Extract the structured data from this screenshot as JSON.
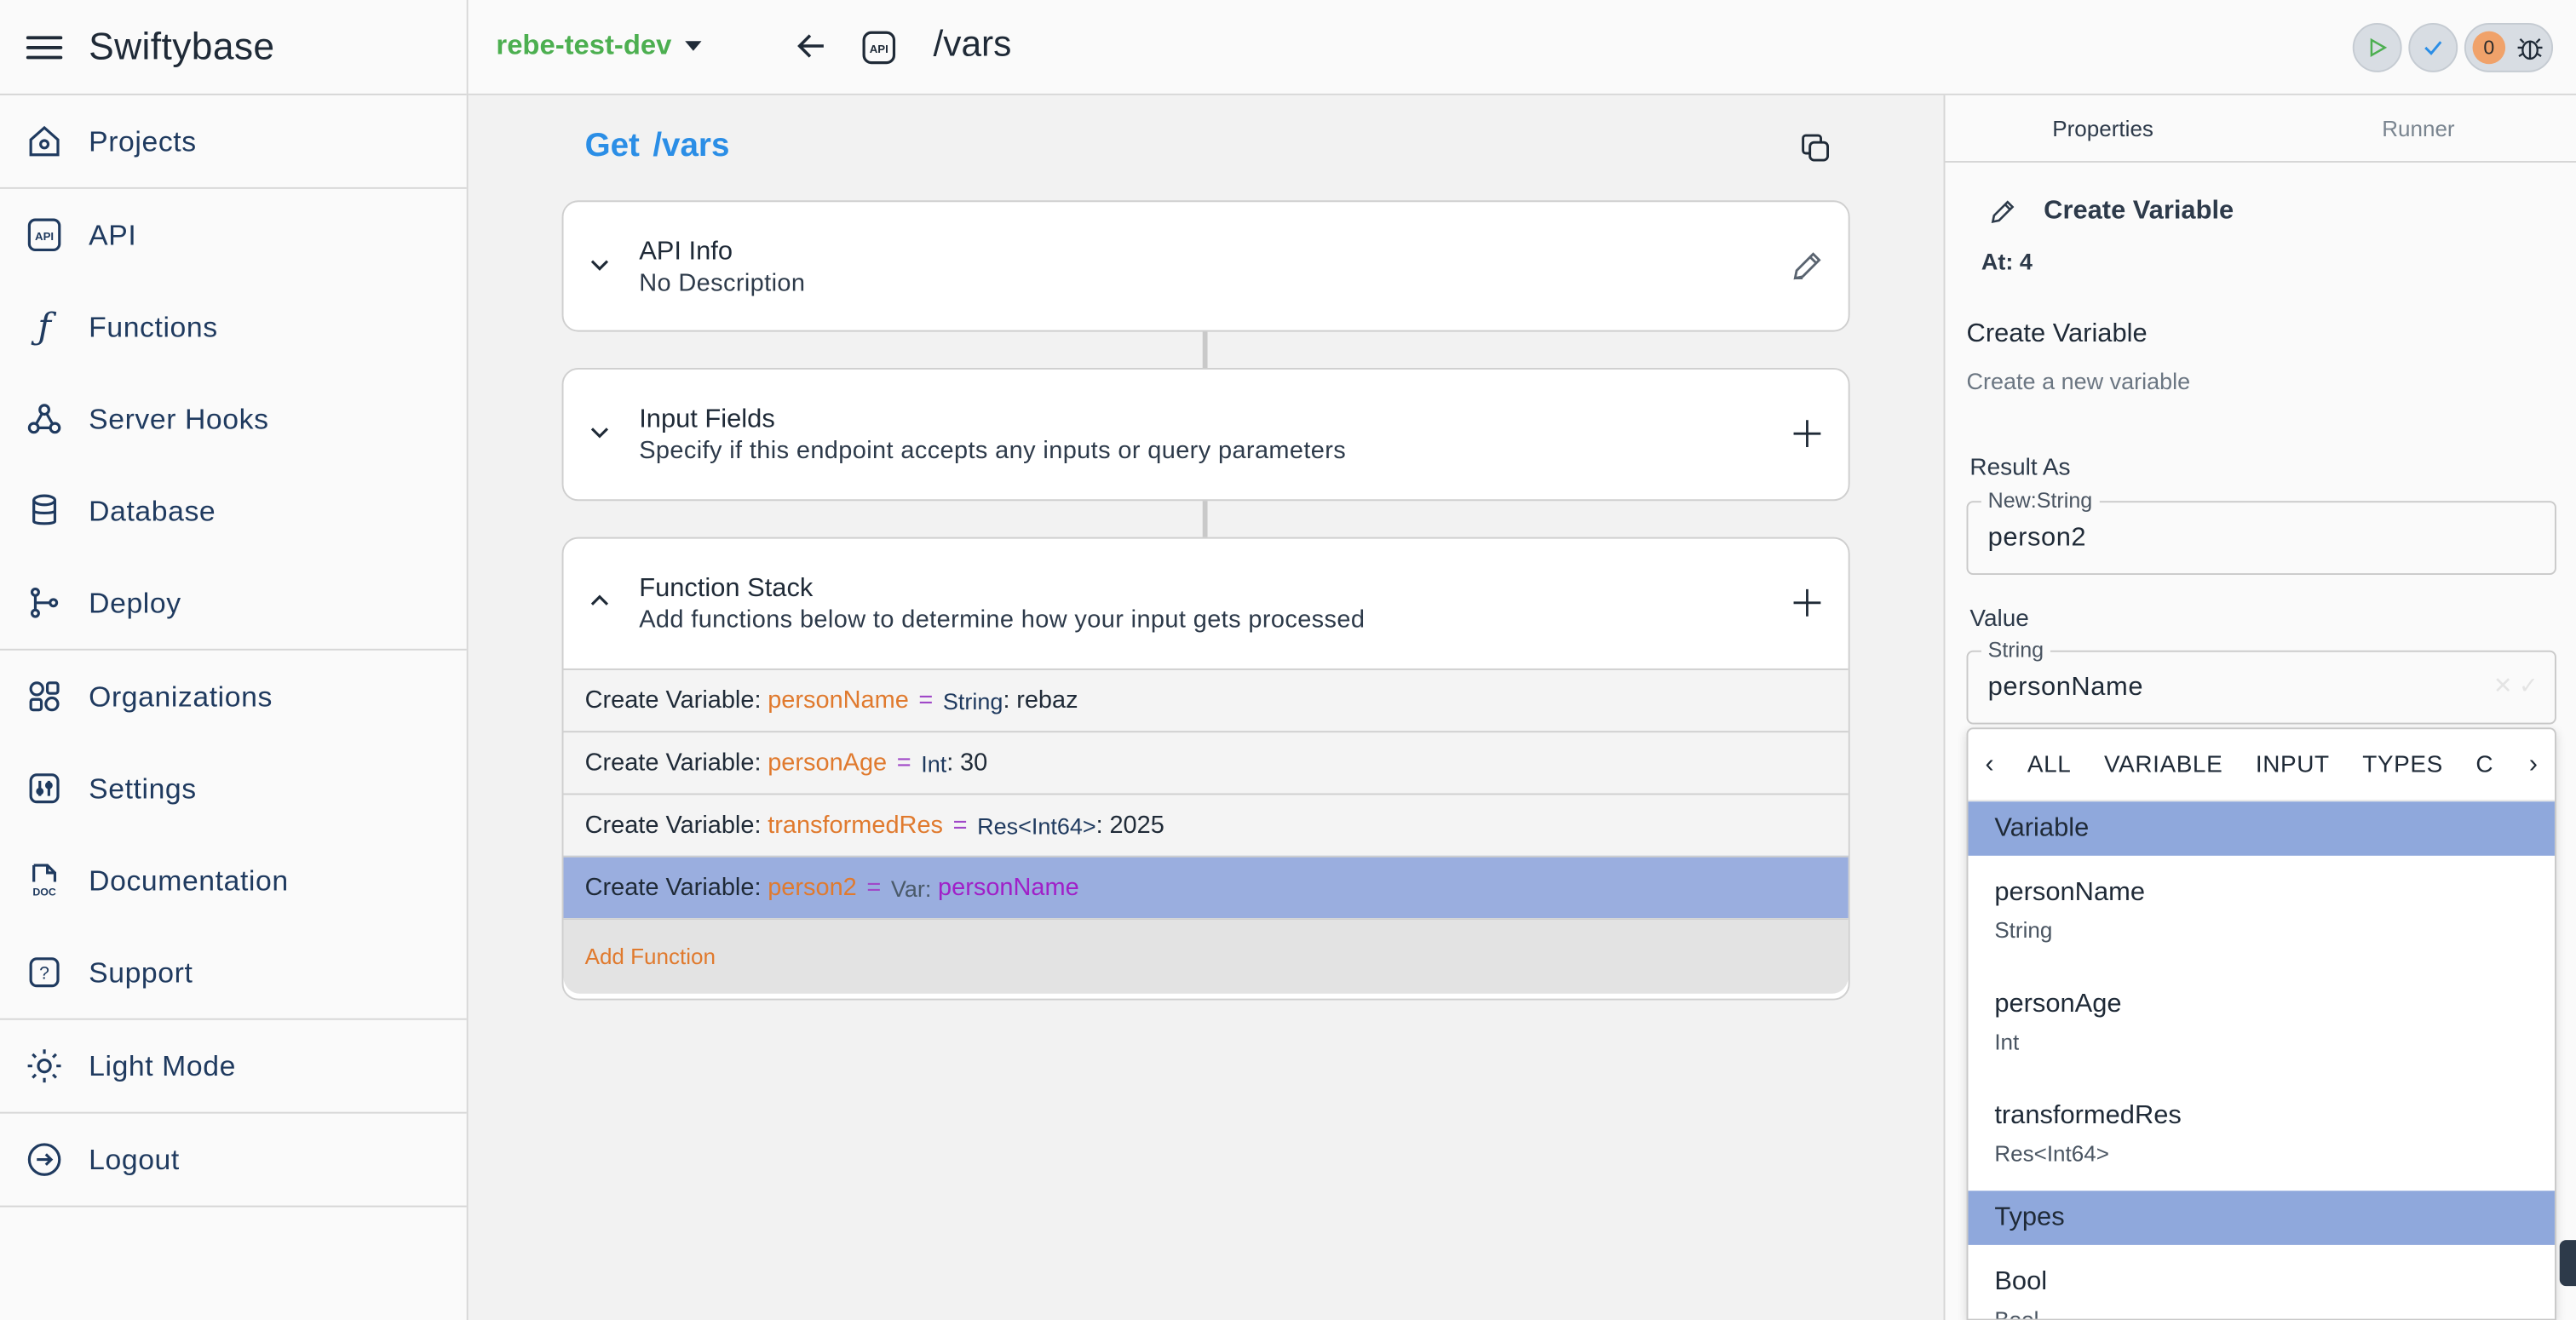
{
  "app": {
    "name": "Swiftybase"
  },
  "sidebar": {
    "items": [
      {
        "label": "Projects",
        "icon": "home-icon"
      },
      {
        "label": "API",
        "icon": "api-icon"
      },
      {
        "label": "Functions",
        "icon": "function-icon"
      },
      {
        "label": "Server Hooks",
        "icon": "webhook-icon"
      },
      {
        "label": "Database",
        "icon": "database-icon"
      },
      {
        "label": "Deploy",
        "icon": "branch-icon"
      },
      {
        "label": "Organizations",
        "icon": "organizations-icon"
      },
      {
        "label": "Settings",
        "icon": "settings-icon"
      },
      {
        "label": "Documentation",
        "icon": "doc-icon"
      },
      {
        "label": "Support",
        "icon": "help-icon"
      },
      {
        "label": "Light Mode",
        "icon": "sun-icon"
      },
      {
        "label": "Logout",
        "icon": "logout-icon"
      }
    ]
  },
  "topbar": {
    "project": "rebe-test-dev",
    "route": "/vars",
    "badge_count": "0"
  },
  "endpoint": {
    "method": "Get",
    "path": "/vars"
  },
  "cards": {
    "api_info": {
      "title": "API Info",
      "subtitle": "No Description"
    },
    "input_fields": {
      "title": "Input Fields",
      "subtitle": "Specify if this endpoint accepts any inputs or query parameters"
    },
    "function_stack": {
      "title": "Function Stack",
      "subtitle": "Add functions below to determine how your input gets processed"
    }
  },
  "function_stack": {
    "rows": [
      {
        "prefix": "Create Variable:",
        "var": "personName",
        "eq": "=",
        "type": "String",
        "sep": ":",
        "value": "rebaz"
      },
      {
        "prefix": "Create Variable:",
        "var": "personAge",
        "eq": "=",
        "type": "Int",
        "sep": ":",
        "value": "30"
      },
      {
        "prefix": "Create Variable:",
        "var": "transformedRes",
        "eq": "=",
        "type": "Res<Int64>",
        "sep": ":",
        "value": "2025"
      },
      {
        "prefix": "Create Variable:",
        "var": "person2",
        "eq": "=",
        "type": "Var",
        "sep": ":",
        "value": "personName"
      }
    ],
    "add_label": "Add Function"
  },
  "right_panel": {
    "tabs": [
      "Properties",
      "Runner"
    ],
    "header": "Create Variable",
    "at": "At: 4",
    "name": "Create Variable",
    "description": "Create a new variable",
    "result_label": "Result As",
    "result_legend": "New:String",
    "result_value": "person2",
    "value_label": "Value",
    "value_legend": "String",
    "value_value": "personName",
    "dropdown": {
      "tabs": [
        "ALL",
        "VARIABLE",
        "INPUT",
        "TYPES",
        "C"
      ],
      "sections": [
        {
          "title": "Variable",
          "items": [
            {
              "name": "personName",
              "type": "String"
            },
            {
              "name": "personAge",
              "type": "Int"
            },
            {
              "name": "transformedRes",
              "type": "Res<Int64>"
            }
          ]
        },
        {
          "title": "Types",
          "items": [
            {
              "name": "Bool",
              "type": "Bool"
            }
          ]
        }
      ]
    }
  }
}
